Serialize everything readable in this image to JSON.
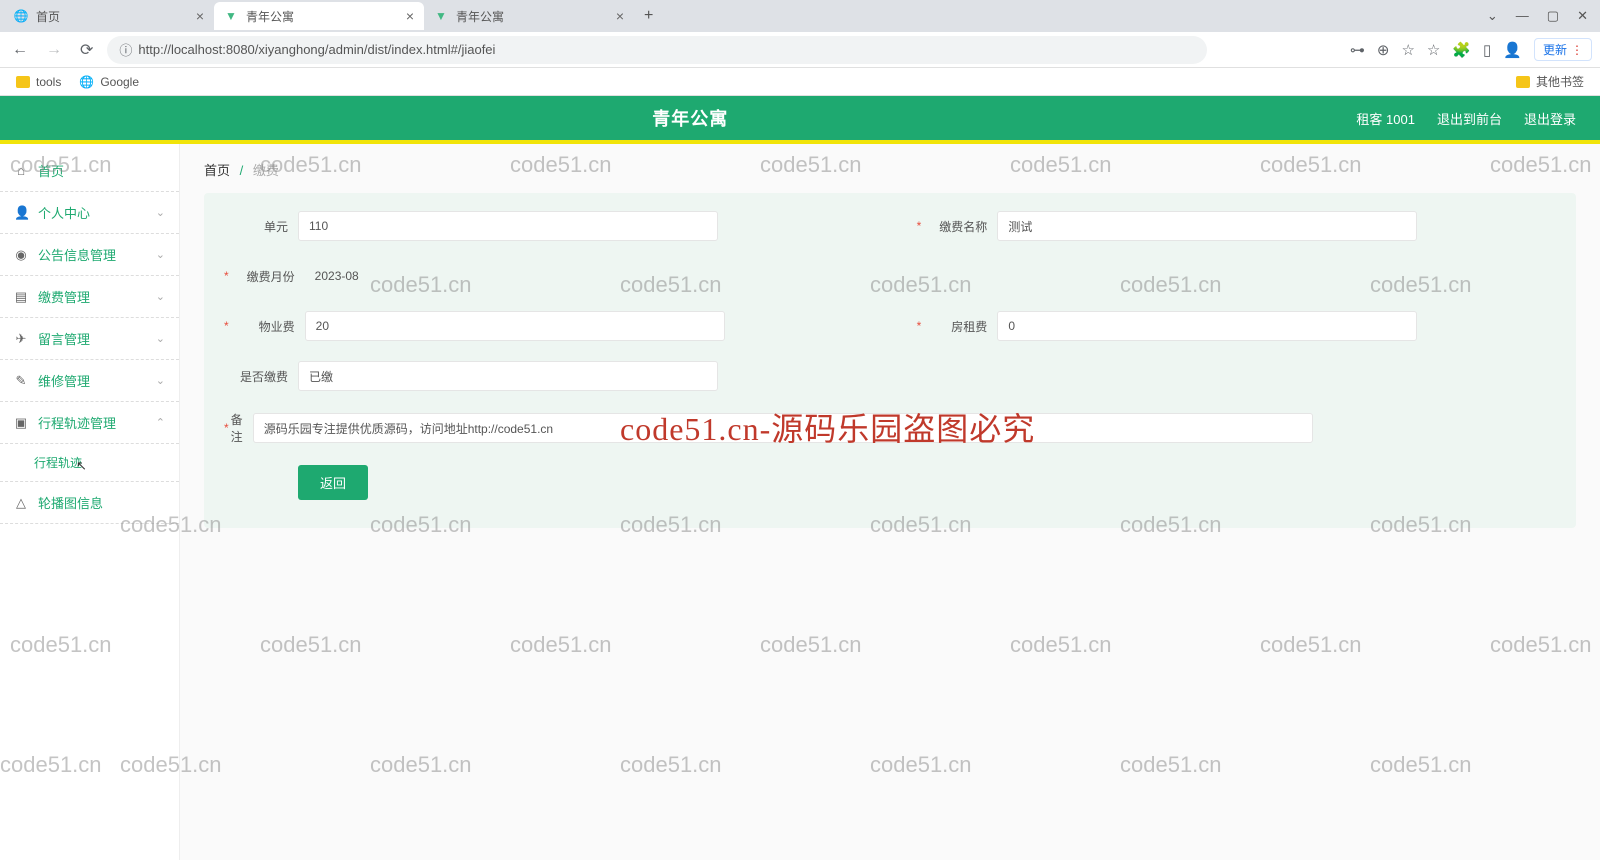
{
  "browser": {
    "tabs": [
      {
        "title": "首页",
        "icon": "globe"
      },
      {
        "title": "青年公寓",
        "icon": "vue",
        "active": true
      },
      {
        "title": "青年公寓",
        "icon": "vue"
      }
    ],
    "url": "http://localhost:8080/xiyanghong/admin/dist/index.html#/jiaofei",
    "update_label": "更新",
    "bookmarks": {
      "tools": "tools",
      "google": "Google",
      "other": "其他书签"
    }
  },
  "header": {
    "title": "青年公寓",
    "user": "租客 1001",
    "to_front": "退出到前台",
    "logout": "退出登录"
  },
  "sidebar": {
    "items": [
      {
        "icon": "home",
        "label": "首页"
      },
      {
        "icon": "user",
        "label": "个人中心",
        "expandable": true
      },
      {
        "icon": "bell",
        "label": "公告信息管理",
        "expandable": true
      },
      {
        "icon": "doc",
        "label": "缴费管理",
        "expandable": true
      },
      {
        "icon": "send",
        "label": "留言管理",
        "expandable": true
      },
      {
        "icon": "wrench",
        "label": "维修管理",
        "expandable": true
      },
      {
        "icon": "route",
        "label": "行程轨迹管理",
        "expandable": true,
        "expanded": true
      },
      {
        "icon": "img",
        "label": "轮播图信息"
      }
    ],
    "sub_item": "行程轨迹"
  },
  "breadcrumb": {
    "home": "首页",
    "current": "缴费"
  },
  "form": {
    "unit": {
      "label": "单元",
      "value": "110"
    },
    "fee_name": {
      "label": "缴费名称",
      "value": "测试"
    },
    "fee_month": {
      "label": "缴费月份",
      "value": "2023-08"
    },
    "property_fee": {
      "label": "物业费",
      "value": "20"
    },
    "rent_fee": {
      "label": "房租费",
      "value": "0"
    },
    "is_paid": {
      "label": "是否缴费",
      "value": "已缴"
    },
    "remark": {
      "label": "备注",
      "value": "源码乐园专注提供优质源码，访问地址http://code51.cn"
    },
    "back_btn": "返回"
  },
  "watermark": "code51.cn",
  "big_watermark": "code51.cn-源码乐园盗图必究"
}
